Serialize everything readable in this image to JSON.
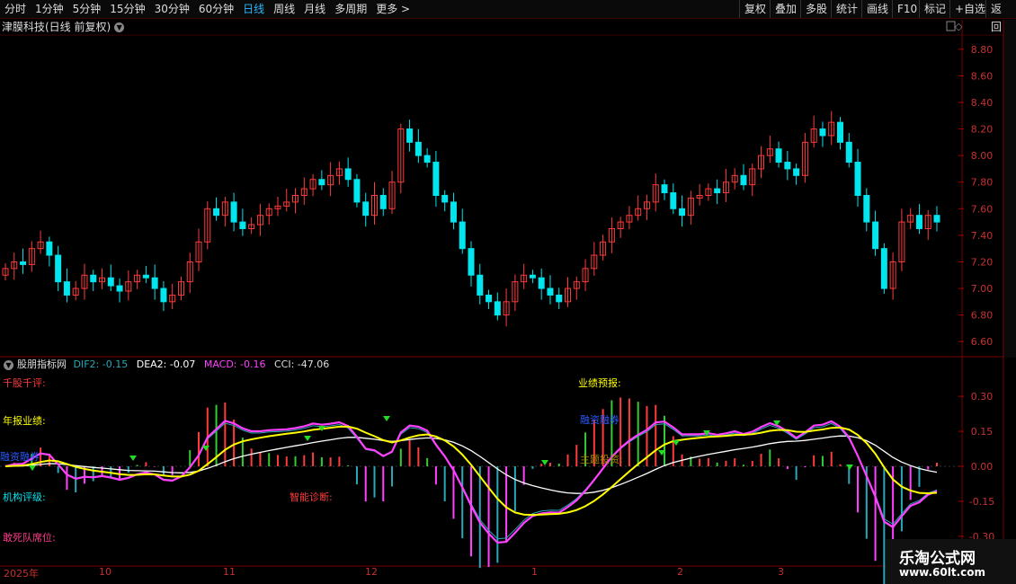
{
  "toolbar": {
    "tabs": [
      "分时",
      "1分钟",
      "5分钟",
      "15分钟",
      "30分钟",
      "60分钟",
      "日线",
      "周线",
      "月线",
      "多周期",
      "更多 >"
    ],
    "active_tab": "日线",
    "right_buttons": [
      "复权",
      "叠加",
      "多股",
      "统计",
      "画线",
      "F10",
      "标记",
      "+自选",
      "返回"
    ]
  },
  "chart_title": "津膜科技(日线 前复权)",
  "indicator": {
    "name": "股朋指标网",
    "dif2": "DIF2: -0.15",
    "dea2": "DEA2: -0.07",
    "macd": "MACD: -0.16",
    "cci": "CCI: -47.06"
  },
  "indicator_labels": {
    "qiangu": "千股千评:",
    "nianbao": "年报业绩:",
    "jigou": "机构评级:",
    "gansi": "敢死队席位:",
    "zhineng": "智能诊断:",
    "yejiyubao": "业绩预报:",
    "zhuli": "主题投资:",
    "rong": "融资融券"
  },
  "x_labels": [
    "2025年",
    "10",
    "11",
    "12",
    "1",
    "2",
    "3"
  ],
  "watermark": {
    "line1": "乐淘公式网",
    "line2": "www.60lt.com"
  },
  "colors": {
    "up": "#ff3b3b",
    "down": "#00e5ee",
    "dif": "#ff40ff",
    "dea": "#ffff00",
    "white": "#ffffff",
    "cyan_line": "#2aa8b8"
  },
  "chart_data": {
    "type": "candlestick",
    "y_ticks_price": [
      "8.80",
      "8.60",
      "8.40",
      "8.20",
      "8.00",
      "7.80",
      "7.60",
      "7.40",
      "7.20",
      "7.00",
      "6.80",
      "6.60"
    ],
    "y_ticks_indicator": [
      "0.30",
      "0.15",
      "0.00",
      "-0.15",
      "-0.30"
    ],
    "close_prices": [
      7.15,
      7.2,
      7.18,
      7.3,
      7.35,
      7.25,
      7.05,
      6.95,
      7.0,
      7.1,
      7.05,
      7.08,
      7.02,
      6.98,
      7.05,
      7.1,
      7.08,
      7.0,
      6.9,
      6.95,
      7.05,
      7.2,
      7.35,
      7.6,
      7.55,
      7.65,
      7.5,
      7.45,
      7.48,
      7.55,
      7.6,
      7.62,
      7.65,
      7.7,
      7.75,
      7.82,
      7.78,
      7.85,
      7.9,
      7.82,
      7.65,
      7.55,
      7.7,
      7.6,
      7.8,
      8.2,
      8.1,
      8.0,
      7.95,
      7.7,
      7.65,
      7.5,
      7.3,
      7.1,
      6.95,
      6.9,
      6.8,
      6.9,
      7.05,
      7.1,
      7.08,
      7.0,
      6.95,
      6.9,
      7.0,
      7.05,
      7.15,
      7.25,
      7.35,
      7.45,
      7.5,
      7.55,
      7.6,
      7.65,
      7.78,
      7.72,
      7.6,
      7.55,
      7.68,
      7.7,
      7.75,
      7.72,
      7.8,
      7.85,
      7.78,
      7.9,
      8.0,
      8.05,
      7.95,
      7.9,
      7.85,
      8.1,
      8.2,
      8.15,
      8.25,
      8.1,
      7.95,
      7.7,
      7.5,
      7.3,
      7.0,
      7.2,
      7.5,
      7.55,
      7.45,
      7.55,
      7.5
    ]
  }
}
